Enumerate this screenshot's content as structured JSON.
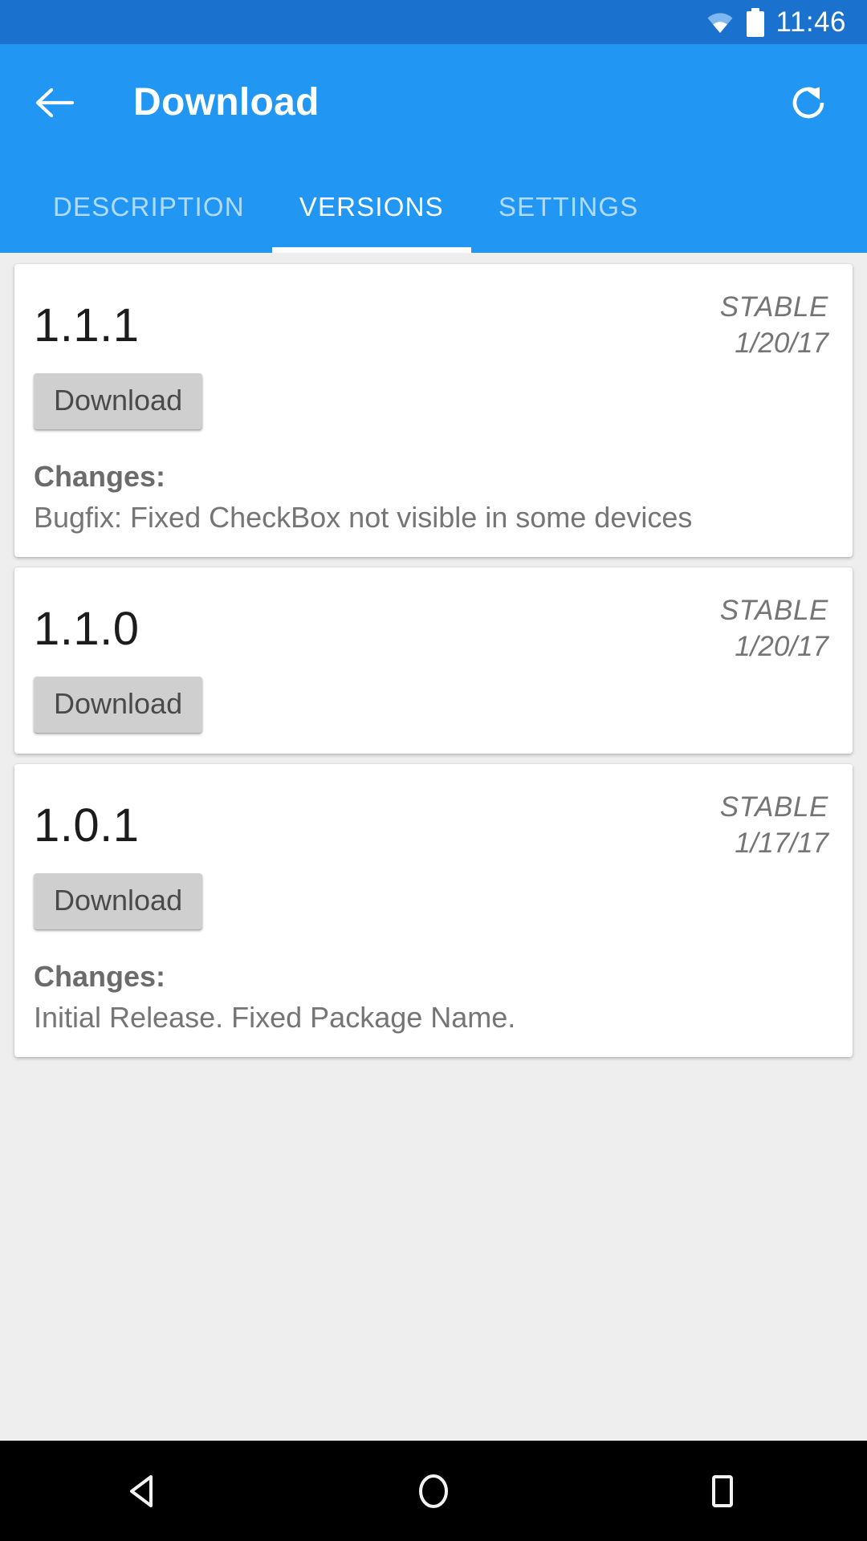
{
  "status_bar": {
    "wifi_icon": "wifi-icon",
    "battery_icon": "battery-full-icon",
    "time": "11:46"
  },
  "app_bar": {
    "back_icon": "arrow-left-icon",
    "title": "Download",
    "refresh_icon": "refresh-icon"
  },
  "tabs": [
    {
      "label": "DESCRIPTION",
      "active": false
    },
    {
      "label": "VERSIONS",
      "active": true
    },
    {
      "label": "SETTINGS",
      "active": false
    }
  ],
  "changes_label": "Changes:",
  "download_label": "Download",
  "versions": [
    {
      "version": "1.1.1",
      "channel": "STABLE",
      "date": "1/20/17",
      "download_label": "Download",
      "changes_label": "Changes:",
      "changes_text": "Bugfix: Fixed CheckBox not visible in some devices"
    },
    {
      "version": "1.1.0",
      "channel": "STABLE",
      "date": "1/20/17",
      "download_label": "Download",
      "changes_label": "",
      "changes_text": ""
    },
    {
      "version": "1.0.1",
      "channel": "STABLE",
      "date": "1/17/17",
      "download_label": "Download",
      "changes_label": "Changes:",
      "changes_text": "Initial Release. Fixed Package Name."
    }
  ],
  "nav_bar": {
    "back_icon": "triangle-back-icon",
    "home_icon": "circle-home-icon",
    "recents_icon": "square-recents-icon"
  },
  "colors": {
    "status_bar": "#1b72ce",
    "app_bar": "#2196f3",
    "background": "#eeeeee",
    "card": "#ffffff",
    "button": "#cfcfcf",
    "nav_bar": "#000000"
  }
}
